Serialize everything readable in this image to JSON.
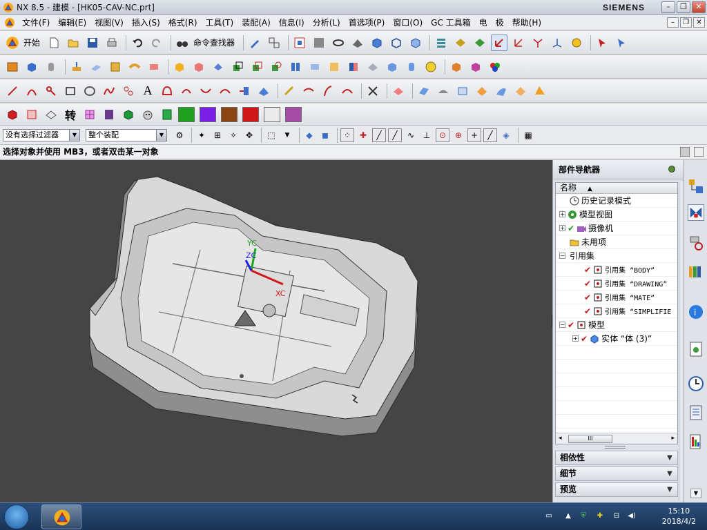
{
  "window": {
    "title": "NX 8.5 - 建模 - [HK05-CAV-NC.prt]",
    "brand": "SIEMENS"
  },
  "menu": {
    "items": [
      "文件(F)",
      "编辑(E)",
      "视图(V)",
      "插入(S)",
      "格式(R)",
      "工具(T)",
      "装配(A)",
      "信息(I)",
      "分析(L)",
      "首选项(P)",
      "窗口(O)",
      "GC 工具箱",
      "电",
      "极",
      "帮助(H)"
    ]
  },
  "toolbar": {
    "start_label": "开始",
    "command_finder_label": "命令查找器",
    "convert_label": "转",
    "row1_icons": [
      "new-icon",
      "open-icon",
      "save-icon",
      "print-icon",
      "undo-icon",
      "redo-icon"
    ],
    "row4_colors": [
      "#1fa01f",
      "#7a1fe6",
      "#8b4513",
      "#d01818",
      "#ebebeb",
      "#a64ca6"
    ]
  },
  "selection_bar": {
    "filter_value": "没有选择过滤器",
    "scope_value": "整个装配"
  },
  "status": {
    "prompt": "选择对象并使用 MB3，或者双击某一对象"
  },
  "viewport": {
    "axis_labels": {
      "yc": "YC",
      "zc": "ZC",
      "xc": "XC"
    }
  },
  "navigator": {
    "title": "部件导航器",
    "column_header": "名称",
    "rows": [
      {
        "label": "历史记录模式"
      },
      {
        "label": "模型视图"
      },
      {
        "label": "摄像机"
      },
      {
        "label": "未用项"
      },
      {
        "label": "引用集"
      },
      {
        "label": "引用集 “BODY”"
      },
      {
        "label": "引用集 “DRAWING”"
      },
      {
        "label": "引用集 “MATE”"
      },
      {
        "label": "引用集 “SIMPLIFIE"
      },
      {
        "label": "模型"
      },
      {
        "label": "实体 “体 (3)”"
      }
    ],
    "scroll_thumb": "III",
    "panels": [
      "相依性",
      "细节",
      "预览"
    ]
  },
  "taskbar": {
    "time": "15:10",
    "date": "2018/4/2"
  }
}
